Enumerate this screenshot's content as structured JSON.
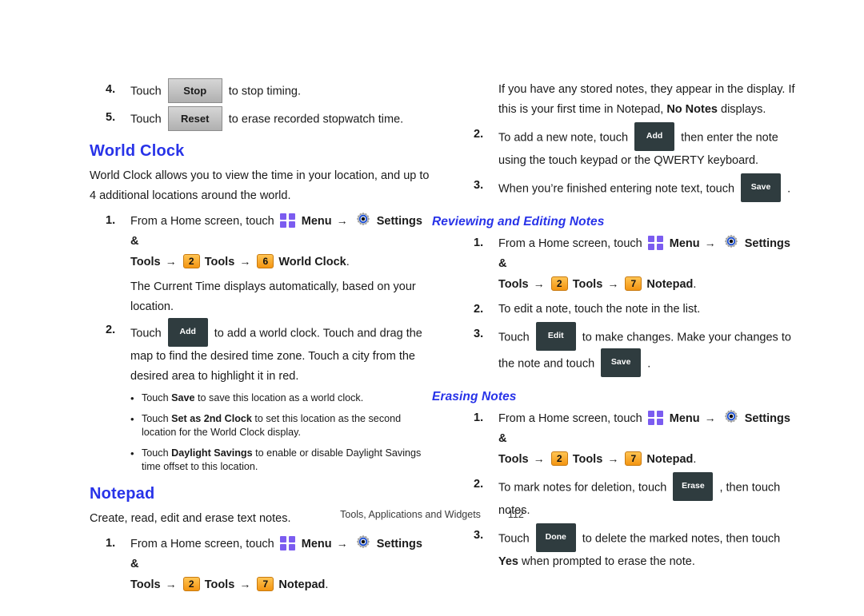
{
  "document": {
    "footer": {
      "section_title": "Tools, Applications and Widgets",
      "page_number": "112"
    }
  },
  "icons": {
    "menu": "menu-grid-icon",
    "settings": "settings-gear-icon",
    "arrow": "→",
    "bullet": "•"
  },
  "colors": {
    "heading": "#2833e8",
    "badge_top": "#ffc453",
    "badge_bottom": "#f39512",
    "softkey": "#2f3c3f",
    "menu_icon": "#7b5cf0",
    "gear_ring": "#1a4fd6"
  },
  "left_column": {
    "step4": {
      "num": "4.",
      "before": "Touch",
      "button": "Stop",
      "after": "to stop timing."
    },
    "step5": {
      "num": "5.",
      "before": "Touch",
      "button": "Reset",
      "after": "to erase recorded stopwatch time."
    },
    "world_clock": {
      "heading": "World Clock",
      "intro": "World Clock allows you to view the time in your location, and up to 4 additional locations around the world.",
      "step1": {
        "num": "1.",
        "lead": "From a Home screen, touch",
        "menu_label": "Menu",
        "settings_label": "Settings &",
        "tools_label": "Tools",
        "badge1": "2",
        "tools2_label": "Tools",
        "badge2": "6",
        "final_label": "World Clock",
        "period": ".",
        "sub": "The Current Time displays automatically, based on your location."
      },
      "step2": {
        "num": "2.",
        "before": "Touch",
        "button": "Add",
        "after": "to add a world clock.  Touch and drag the map to find the desired time zone. Touch a city from the desired area to highlight it in red."
      },
      "bullets": [
        {
          "before": "Touch ",
          "bold": "Save",
          "after": " to save this location as a world clock."
        },
        {
          "before": "Touch ",
          "bold": "Set as 2nd Clock",
          "after": " to set this location as the second location for the World Clock display."
        },
        {
          "before": "Touch ",
          "bold": "Daylight Savings",
          "after": " to enable or disable Daylight Savings time offset to this location."
        }
      ]
    },
    "notepad": {
      "heading": "Notepad",
      "intro": "Create, read, edit and erase text notes.",
      "step1": {
        "num": "1.",
        "lead": "From a Home screen, touch",
        "menu_label": "Menu",
        "settings_label": "Settings &",
        "tools_label": "Tools",
        "badge1": "2",
        "tools2_label": "Tools",
        "badge2": "7",
        "final_label": "Notepad",
        "period": "."
      }
    }
  },
  "right_column": {
    "notes_intro": {
      "part1": "If you have any stored notes, they appear in the display. If this is your first time in Notepad, ",
      "bold": "No Notes",
      "part2": " displays."
    },
    "step2": {
      "num": "2.",
      "before": "To add a new note, touch",
      "button": "Add",
      "after": "then enter the note using the touch keypad or the QWERTY keyboard."
    },
    "step3": {
      "num": "3.",
      "before": "When you’re finished entering note text, touch",
      "button": "Save",
      "after": "."
    },
    "reviewing": {
      "heading": "Reviewing and Editing Notes",
      "step1": {
        "num": "1.",
        "lead": "From a Home screen, touch",
        "menu_label": "Menu",
        "settings_label": "Settings &",
        "tools_label": "Tools",
        "badge1": "2",
        "tools2_label": "Tools",
        "badge2": "7",
        "final_label": "Notepad",
        "period": "."
      },
      "step2": {
        "num": "2.",
        "text": "To edit a note, touch the note in the list."
      },
      "step3": {
        "num": "3.",
        "before": "Touch",
        "button1": "Edit",
        "middle": "to make changes. Make your changes to the note and touch",
        "button2": "Save",
        "after": "."
      }
    },
    "erasing": {
      "heading": "Erasing Notes",
      "step1": {
        "num": "1.",
        "lead": "From a Home screen, touch",
        "menu_label": "Menu",
        "settings_label": "Settings &",
        "tools_label": "Tools",
        "badge1": "2",
        "tools2_label": "Tools",
        "badge2": "7",
        "final_label": "Notepad",
        "period": "."
      },
      "step2": {
        "num": "2.",
        "before": "To mark notes for deletion, touch",
        "button": "Erase",
        "after": ", then touch notes."
      },
      "step3": {
        "num": "3.",
        "before": "Touch",
        "button": "Done",
        "middle": "to delete the marked notes, then touch ",
        "bold": "Yes",
        "after": " when prompted to erase the note."
      }
    }
  }
}
